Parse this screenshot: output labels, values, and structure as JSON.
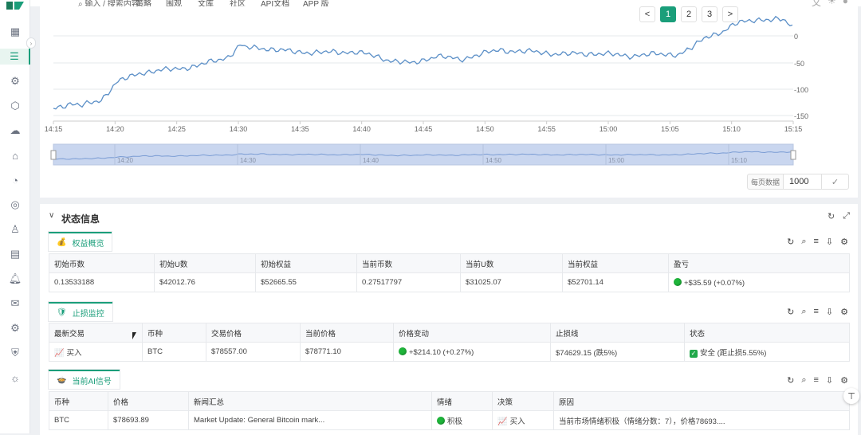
{
  "nav": {
    "search_placeholder": "输入 / 搜索内容",
    "items": [
      "策略",
      "围观",
      "文库",
      "社区",
      "API文档",
      "APP 版"
    ]
  },
  "chart": {
    "y_ticks": [
      "0",
      "-50",
      "-100",
      "-150"
    ],
    "x_ticks": [
      "14:15",
      "14:20",
      "14:25",
      "14:30",
      "14:35",
      "14:40",
      "14:45",
      "14:50",
      "14:55",
      "15:00",
      "15:05",
      "15:10",
      "15:15"
    ],
    "zoom_ticks": [
      "14:20",
      "14:30",
      "14:40",
      "14:50",
      "15:00",
      "15:10"
    ],
    "line_color": "#5b8fc7"
  },
  "pagination": {
    "prev": "<",
    "pages": [
      "1",
      "2",
      "3"
    ],
    "next": ">",
    "active": "1",
    "page_size_label": "每页数据",
    "page_size_value": "1000",
    "confirm": "✓"
  },
  "status": {
    "title": "状态信息",
    "equity": {
      "tab": "权益概览",
      "tab_icon": "💰",
      "headers": [
        "初始币数",
        "初始U数",
        "初始权益",
        "当前币数",
        "当前U数",
        "当前权益",
        "盈亏"
      ],
      "row": [
        "0.13533188",
        "$42012.76",
        "$52665.55",
        "0.27517797",
        "$31025.07",
        "$52701.14",
        "+$35.59 (+0.07%)"
      ]
    },
    "stoploss": {
      "tab": "止损监控",
      "tab_icon": "🛡",
      "headers": [
        "最新交易",
        "币种",
        "交易价格",
        "当前价格",
        "价格变动",
        "止损线",
        "状态"
      ],
      "row": [
        "买入",
        "BTC",
        "$78557.00",
        "$78771.10",
        "+$214.10 (+0.27%)",
        "$74629.15 (跌5%)",
        "安全 (距止损5.55%)"
      ]
    },
    "ai_signal": {
      "tab": "当前AI信号",
      "tab_icon": "🍲",
      "headers": [
        "币种",
        "价格",
        "新闻汇总",
        "情绪",
        "决策",
        "原因"
      ],
      "row": [
        "BTC",
        "$78693.89",
        "Market Update: General Bitcoin mark...",
        "积极",
        "买入",
        "当前市场情绪积极（情绪分数：7），价格78693...."
      ]
    }
  }
}
